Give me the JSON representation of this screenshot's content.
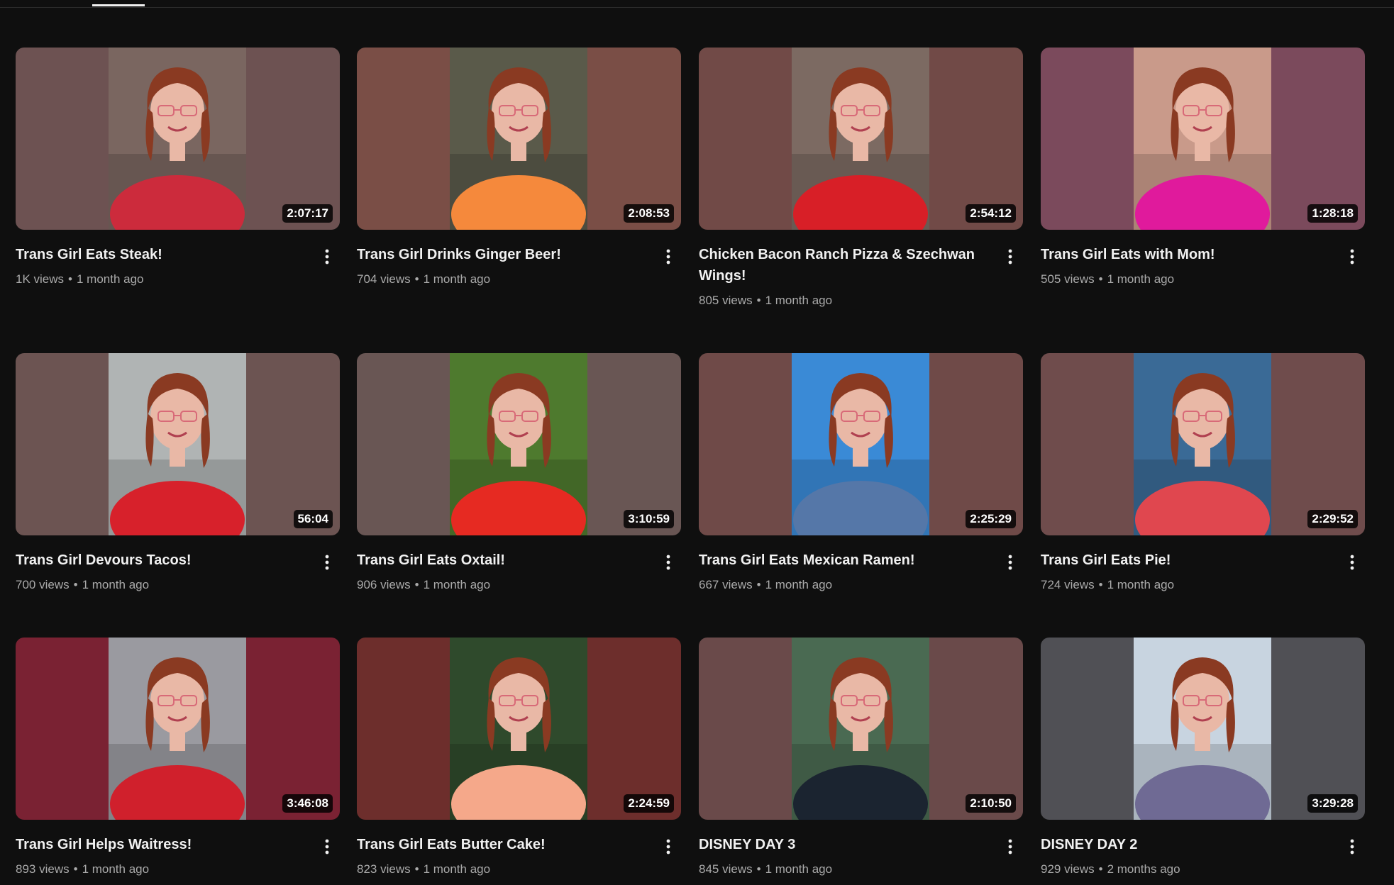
{
  "colors": {
    "background": "#0f0f0f",
    "title": "#f1f1f1",
    "secondary_text": "#aaaaaa",
    "duration_bg": "#000000",
    "active_tab_underline": "#f1f1f1"
  },
  "videos": [
    {
      "title": "Trans Girl Eats Steak!",
      "views": "1K views",
      "age": "1 month ago",
      "duration": "2:07:17",
      "thumb_bg": "#6d5252",
      "scene": "#7a6660",
      "accent": "#cc2b3c"
    },
    {
      "title": "Trans Girl Drinks Ginger Beer!",
      "views": "704 views",
      "age": "1 month ago",
      "duration": "2:08:53",
      "thumb_bg": "#7a4e46",
      "scene": "#5a5a4a",
      "accent": "#f5893c"
    },
    {
      "title": "Chicken Bacon Ranch Pizza & Szechwan Wings!",
      "views": "805 views",
      "age": "1 month ago",
      "duration": "2:54:12",
      "thumb_bg": "#714a47",
      "scene": "#7c6a62",
      "accent": "#d81f27"
    },
    {
      "title": "Trans Girl Eats with Mom!",
      "views": "505 views",
      "age": "1 month ago",
      "duration": "1:28:18",
      "thumb_bg": "#7b4a5c",
      "scene": "#c99a8a",
      "accent": "#e01a9c"
    },
    {
      "title": "Trans Girl Devours Tacos!",
      "views": "700 views",
      "age": "1 month ago",
      "duration": "56:04",
      "thumb_bg": "#6c5452",
      "scene": "#b0b4b4",
      "accent": "#d7212b"
    },
    {
      "title": "Trans Girl Eats Oxtail!",
      "views": "906 views",
      "age": "1 month ago",
      "duration": "3:10:59",
      "thumb_bg": "#695654",
      "scene": "#4e7a2e",
      "accent": "#e62a22"
    },
    {
      "title": "Trans Girl Eats Mexican Ramen!",
      "views": "667 views",
      "age": "1 month ago",
      "duration": "2:25:29",
      "thumb_bg": "#6f4a48",
      "scene": "#3a8ad6",
      "accent": "#5577a8"
    },
    {
      "title": "Trans Girl Eats Pie!",
      "views": "724 views",
      "age": "1 month ago",
      "duration": "2:29:52",
      "thumb_bg": "#6f4c4c",
      "scene": "#3a6a96",
      "accent": "#e0474f"
    },
    {
      "title": "Trans Girl Helps Waitress!",
      "views": "893 views",
      "age": "1 month ago",
      "duration": "3:46:08",
      "thumb_bg": "#7a2233",
      "scene": "#9a9aa0",
      "accent": "#d0202c"
    },
    {
      "title": "Trans Girl Eats Butter Cake!",
      "views": "823 views",
      "age": "1 month ago",
      "duration": "2:24:59",
      "thumb_bg": "#6d2e2c",
      "scene": "#2f4a2c",
      "accent": "#f5a88a"
    },
    {
      "title": "DISNEY DAY 3",
      "views": "845 views",
      "age": "1 month ago",
      "duration": "2:10:50",
      "thumb_bg": "#6a4a4a",
      "scene": "#4a6a52",
      "accent": "#1b2430"
    },
    {
      "title": "DISNEY DAY 2",
      "views": "929 views",
      "age": "2 months ago",
      "duration": "3:29:28",
      "thumb_bg": "#505055",
      "scene": "#c8d4e0",
      "accent": "#6f6a94"
    }
  ]
}
